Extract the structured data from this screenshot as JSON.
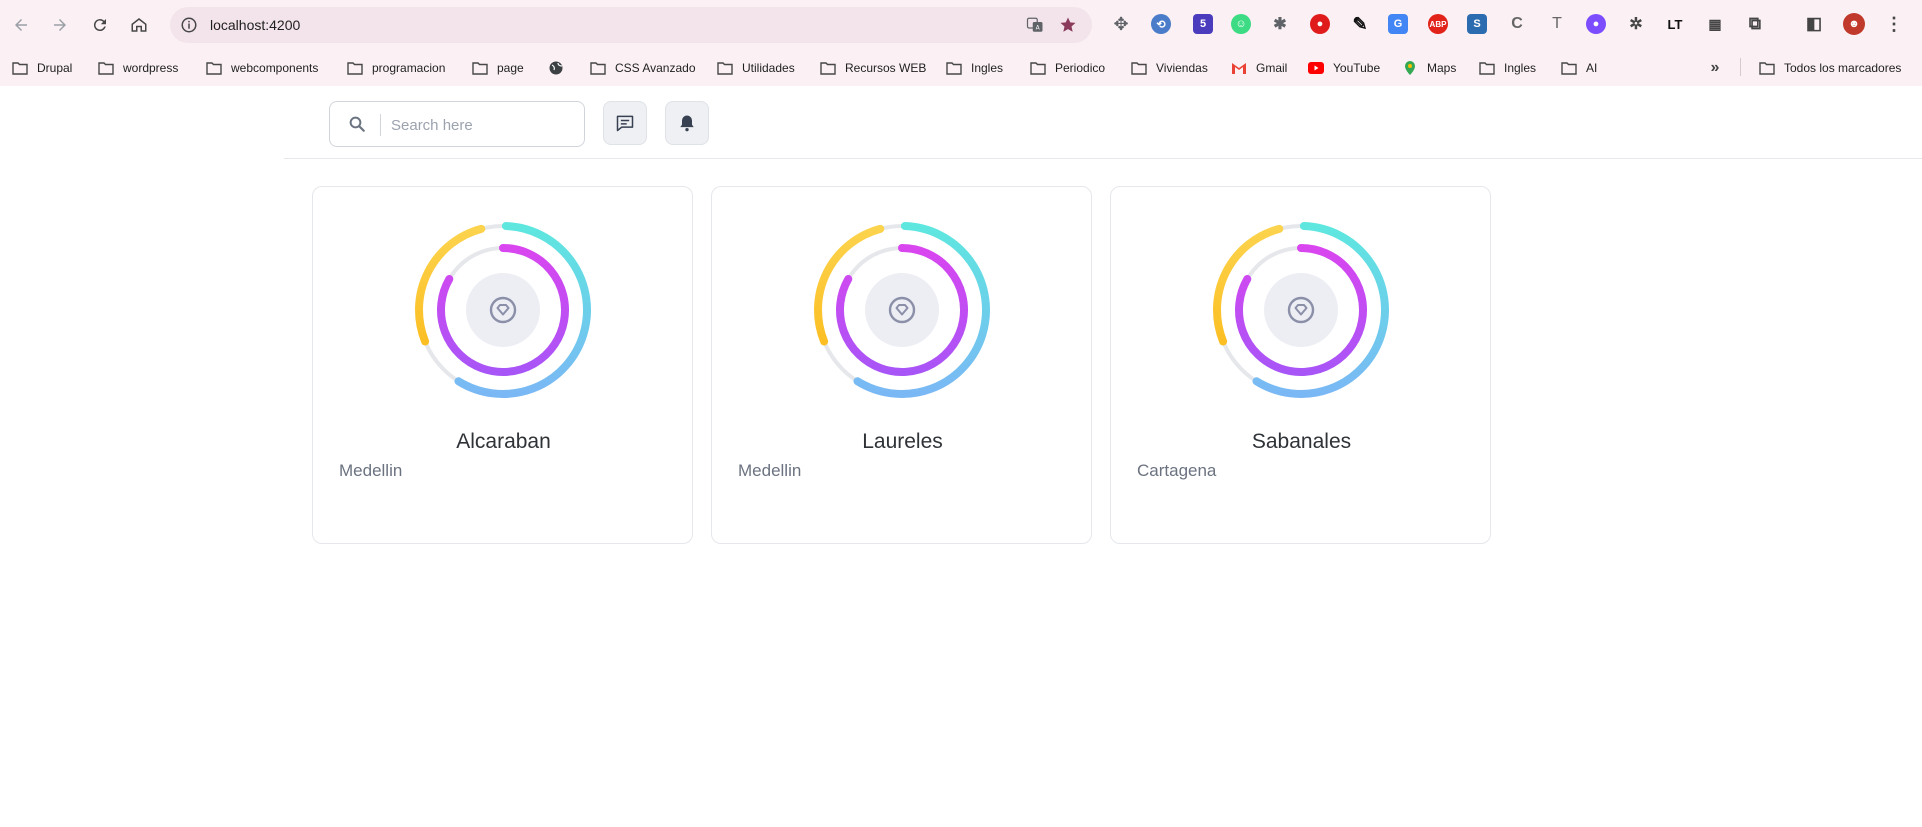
{
  "browser": {
    "url": "localhost:4200",
    "bookmarks": [
      {
        "label": "Drupal",
        "icon": "folder-icon"
      },
      {
        "label": "wordpress",
        "icon": "folder-icon"
      },
      {
        "label": "webcomponents",
        "icon": "folder-icon"
      },
      {
        "label": "programacion",
        "icon": "folder-icon"
      },
      {
        "label": "page",
        "icon": "folder-icon"
      },
      {
        "label": "",
        "icon": "globe-icon"
      },
      {
        "label": "CSS Avanzado",
        "icon": "folder-icon"
      },
      {
        "label": "Utilidades",
        "icon": "folder-icon"
      },
      {
        "label": "Recursos WEB",
        "icon": "folder-icon"
      },
      {
        "label": "Ingles",
        "icon": "folder-icon"
      },
      {
        "label": "Periodico",
        "icon": "folder-icon"
      },
      {
        "label": "Viviendas",
        "icon": "folder-icon"
      },
      {
        "label": "Gmail",
        "icon": "gmail-icon"
      },
      {
        "label": "YouTube",
        "icon": "youtube-icon"
      },
      {
        "label": "Maps",
        "icon": "maps-icon"
      },
      {
        "label": "Ingles",
        "icon": "folder-icon"
      },
      {
        "label": "AI",
        "icon": "folder-icon"
      }
    ],
    "all_bookmarks": "Todos los marcadores"
  },
  "header": {
    "search_placeholder": "Search here"
  },
  "cards": [
    {
      "name": "Alcaraban",
      "city": "Medellin"
    },
    {
      "name": "Laureles",
      "city": "Medellin"
    },
    {
      "name": "Sabanales",
      "city": "Cartagena"
    }
  ],
  "colors": {
    "ring_outer_cyan": "#5ee7df",
    "ring_outer_blue": "#7ab8f5",
    "ring_yellow": "#fcd34d",
    "ring_orange": "#fbbf24",
    "ring_magenta": "#d946ef",
    "ring_purple": "#a855f7",
    "ring_track": "#e5e7eb",
    "center_bg": "#eceef4",
    "center_icon": "#8b8fa8"
  }
}
